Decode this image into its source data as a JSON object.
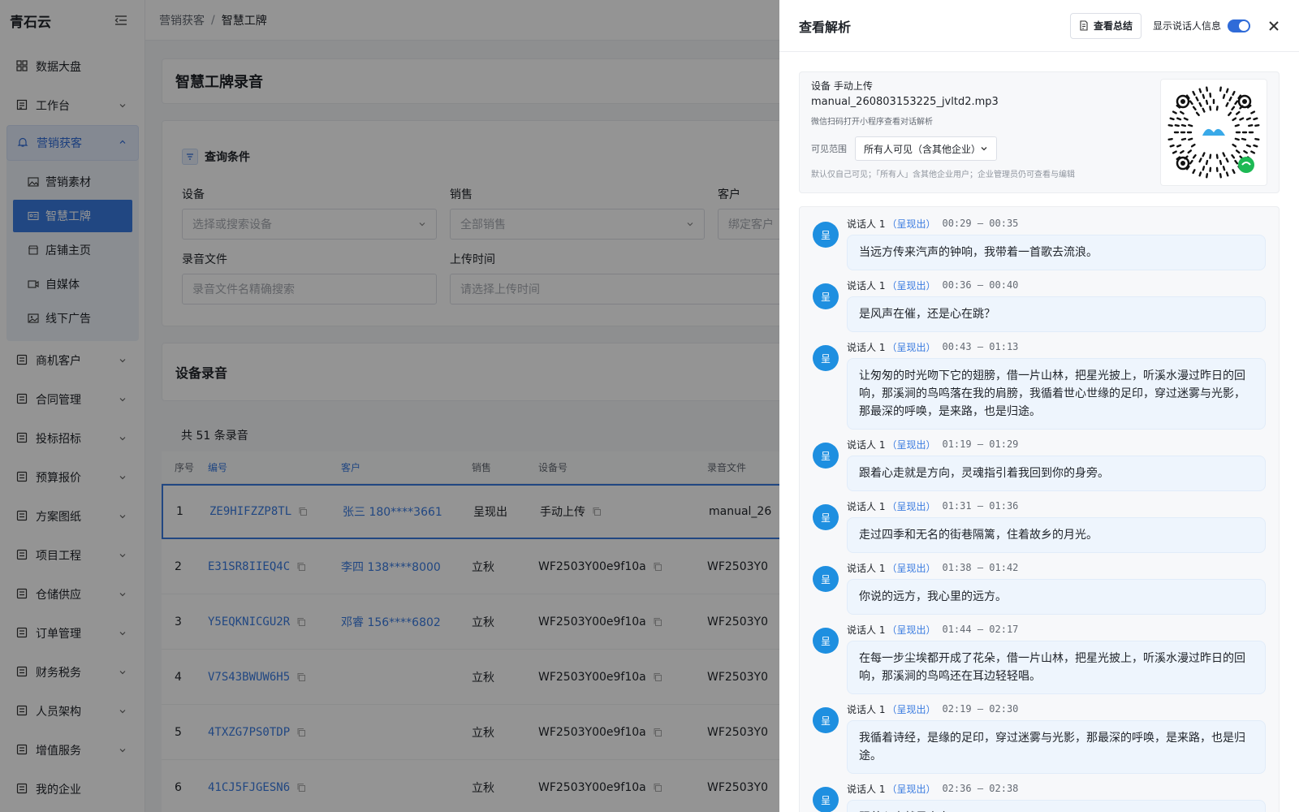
{
  "app": {
    "logo": "青石云"
  },
  "nav": {
    "items_top": [
      {
        "label": "数据大盘",
        "icon": "dashboard-icon"
      },
      {
        "label": "工作台",
        "icon": "workbench-icon"
      }
    ],
    "group_open": {
      "label": "营销获客",
      "sub": [
        {
          "label": "营销素材"
        },
        {
          "label": "智慧工牌"
        },
        {
          "label": "店铺主页"
        },
        {
          "label": "自媒体"
        },
        {
          "label": "线下广告"
        }
      ]
    },
    "items_bottom": [
      {
        "label": "商机客户"
      },
      {
        "label": "合同管理"
      },
      {
        "label": "投标招标"
      },
      {
        "label": "预算报价"
      },
      {
        "label": "方案图纸"
      },
      {
        "label": "项目工程"
      },
      {
        "label": "仓储供应"
      },
      {
        "label": "订单管理"
      },
      {
        "label": "财务税务"
      },
      {
        "label": "人员架构"
      },
      {
        "label": "增值服务"
      },
      {
        "label": "我的企业"
      }
    ]
  },
  "breadcrumb": {
    "parent": "营销获客",
    "sep": "/",
    "current": "智慧工牌"
  },
  "page": {
    "title": "智慧工牌录音"
  },
  "query": {
    "title": "查询条件",
    "device_label": "设备",
    "device_placeholder": "选择或搜索设备",
    "sales_label": "销售",
    "sales_placeholder": "全部销售",
    "customer_label": "客户",
    "customer_placeholder": "绑定客户",
    "file_label": "录音文件",
    "file_placeholder": "录音文件名精确搜索",
    "time_label": "上传时间",
    "time_placeholder": "请选择上传时间"
  },
  "records": {
    "section_title": "设备录音",
    "total": "共 51 条录音",
    "columns": [
      "序号",
      "编号",
      "客户",
      "销售",
      "设备号",
      "录音文件"
    ],
    "rows": [
      {
        "idx": "1",
        "code": "ZE9HIFZZP8TL",
        "customer": "张三 180****3661",
        "sales": "呈现出",
        "device": "手动上传",
        "file": "manual_26"
      },
      {
        "idx": "2",
        "code": "E31SR8IIEQ4C",
        "customer": "李四 138****8000",
        "sales": "立秋",
        "device": "WF2503Y00e9f10a",
        "file": "WF2503Y0"
      },
      {
        "idx": "3",
        "code": "Y5EQKNICGU2R",
        "customer": "邓睿 156****6802",
        "sales": "立秋",
        "device": "WF2503Y00e9f10a",
        "file": "WF2503Y0"
      },
      {
        "idx": "4",
        "code": "V7S43BWUW6H5",
        "customer": "",
        "sales": "立秋",
        "device": "WF2503Y00e9f10a",
        "file": "WF2503Y0"
      },
      {
        "idx": "5",
        "code": "4TXZG7PS0TDP",
        "customer": "",
        "sales": "立秋",
        "device": "WF2503Y00e9f10a",
        "file": "WF2503Y0"
      },
      {
        "idx": "6",
        "code": "41CJ5FJGESN6",
        "customer": "",
        "sales": "立秋",
        "device": "WF2503Y00e9f10a",
        "file": "WF2503Y0"
      }
    ]
  },
  "drawer": {
    "title": "查看解析",
    "summary_label": "查看总结",
    "toggle_label": "显示说话人信息",
    "toggle_on": true,
    "device_line": "设备 手动上传",
    "file_name": "manual_260803153225_jvltd2.mp3",
    "qr_hint": "微信扫码打开小程序查看对话解析",
    "visibility_label": "可见范围",
    "visibility_value": "所有人可见（含其他企业）",
    "visibility_note": "默认仅自己可见；「所有人」含其他企业用户；企业管理员仍可查看与编辑",
    "messages": [
      {
        "avatar": "呈",
        "speaker": "说话人 1",
        "tag": "（呈现出）",
        "time": "00:29 — 00:35",
        "text": "当远方传来汽声的钟响，我带着一首歌去流浪。"
      },
      {
        "avatar": "呈",
        "speaker": "说话人 1",
        "tag": "（呈现出）",
        "time": "00:36 — 00:40",
        "text": "是风声在催，还是心在跳？"
      },
      {
        "avatar": "呈",
        "speaker": "说话人 1",
        "tag": "（呈现出）",
        "time": "00:43 — 01:13",
        "text": "让匆匆的时光吻下它的翅膀，借一片山林，把星光披上，听溪水漫过昨日的回响，那溪涧的鸟鸣落在我的肩膀，我循着世心世缘的足印，穿过迷雾与光影，那最深的呼唤，是来路，也是归途。"
      },
      {
        "avatar": "呈",
        "speaker": "说话人 1",
        "tag": "（呈现出）",
        "time": "01:19 — 01:29",
        "text": "跟着心走就是方向，灵魂指引着我回到你的身旁。"
      },
      {
        "avatar": "呈",
        "speaker": "说话人 1",
        "tag": "（呈现出）",
        "time": "01:31 — 01:36",
        "text": "走过四季和无名的街巷隔篱，住着故乡的月光。"
      },
      {
        "avatar": "呈",
        "speaker": "说话人 1",
        "tag": "（呈现出）",
        "time": "01:38 — 01:42",
        "text": "你说的远方，我心里的远方。"
      },
      {
        "avatar": "呈",
        "speaker": "说话人 1",
        "tag": "（呈现出）",
        "time": "01:44 — 02:17",
        "text": "在每一步尘埃都开成了花朵，借一片山林，把星光披上，听溪水漫过昨日的回响，那溪涧的鸟鸣还在耳边轻轻唱。"
      },
      {
        "avatar": "呈",
        "speaker": "说话人 1",
        "tag": "（呈现出）",
        "time": "02:19 — 02:30",
        "text": "我循着诗经，是缘的足印，穿过迷雾与光影，那最深的呼唤，是来路，也是归途。"
      },
      {
        "avatar": "呈",
        "speaker": "说话人 1",
        "tag": "（呈现出）",
        "time": "02:36 — 02:38",
        "text": "跟着心走就是方向"
      }
    ]
  },
  "colors": {
    "accent": "#3a7be0",
    "avatar": "#1e8fe0",
    "overlay": "rgba(0,0,0,0.42)"
  }
}
